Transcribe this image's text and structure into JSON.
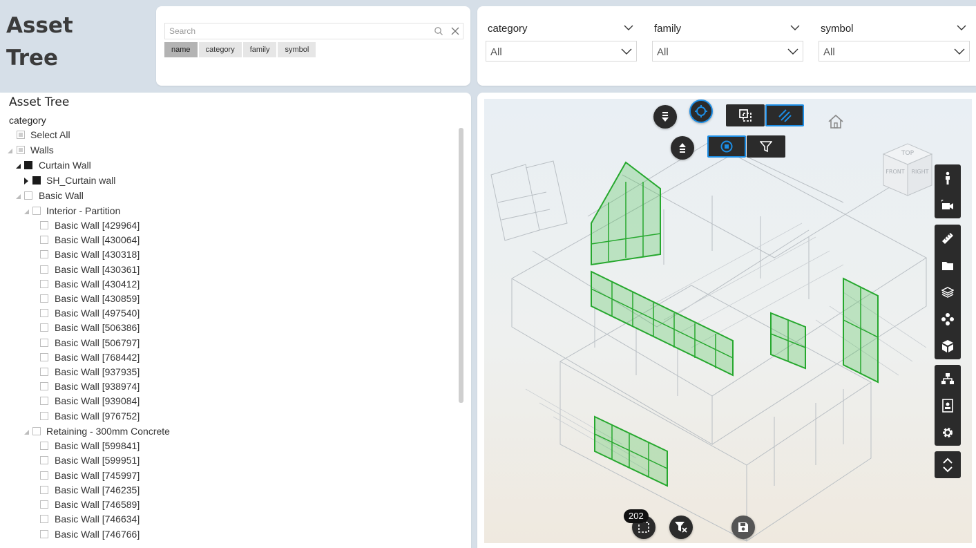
{
  "app": {
    "title_line1": "Asset",
    "title_line2": "Tree"
  },
  "search": {
    "placeholder": "Search",
    "fields": [
      "name",
      "category",
      "family",
      "symbol"
    ],
    "active_field": "name"
  },
  "filters": [
    {
      "label": "category",
      "value": "All"
    },
    {
      "label": "family",
      "value": "All"
    },
    {
      "label": "symbol",
      "value": "All"
    }
  ],
  "tree": {
    "title": "Asset Tree",
    "field": "category",
    "rows": [
      {
        "label": "Select All"
      },
      {
        "label": "Walls"
      },
      {
        "label": "Curtain Wall"
      },
      {
        "label": "SH_Curtain wall"
      },
      {
        "label": "Basic Wall"
      },
      {
        "label": "Interior - Partition"
      },
      {
        "label": "Basic Wall [429964]"
      },
      {
        "label": "Basic Wall [430064]"
      },
      {
        "label": "Basic Wall [430318]"
      },
      {
        "label": "Basic Wall [430361]"
      },
      {
        "label": "Basic Wall [430412]"
      },
      {
        "label": "Basic Wall [430859]"
      },
      {
        "label": "Basic Wall [497540]"
      },
      {
        "label": "Basic Wall [506386]"
      },
      {
        "label": "Basic Wall [506797]"
      },
      {
        "label": "Basic Wall [768442]"
      },
      {
        "label": "Basic Wall [937935]"
      },
      {
        "label": "Basic Wall [938974]"
      },
      {
        "label": "Basic Wall [939084]"
      },
      {
        "label": "Basic Wall [976752]"
      },
      {
        "label": "Retaining - 300mm Concrete"
      },
      {
        "label": "Basic Wall [599841]"
      },
      {
        "label": "Basic Wall [599951]"
      },
      {
        "label": "Basic Wall [745997]"
      },
      {
        "label": "Basic Wall [746235]"
      },
      {
        "label": "Basic Wall [746589]"
      },
      {
        "label": "Basic Wall [746634]"
      },
      {
        "label": "Basic Wall [746766]"
      }
    ]
  },
  "viewer": {
    "selection_count": "202",
    "viewcube": {
      "top": "TOP",
      "front": "FRONT",
      "right": "RIGHT"
    },
    "accent_color": "#1c8ee6",
    "highlight_color": "#22a52a"
  }
}
